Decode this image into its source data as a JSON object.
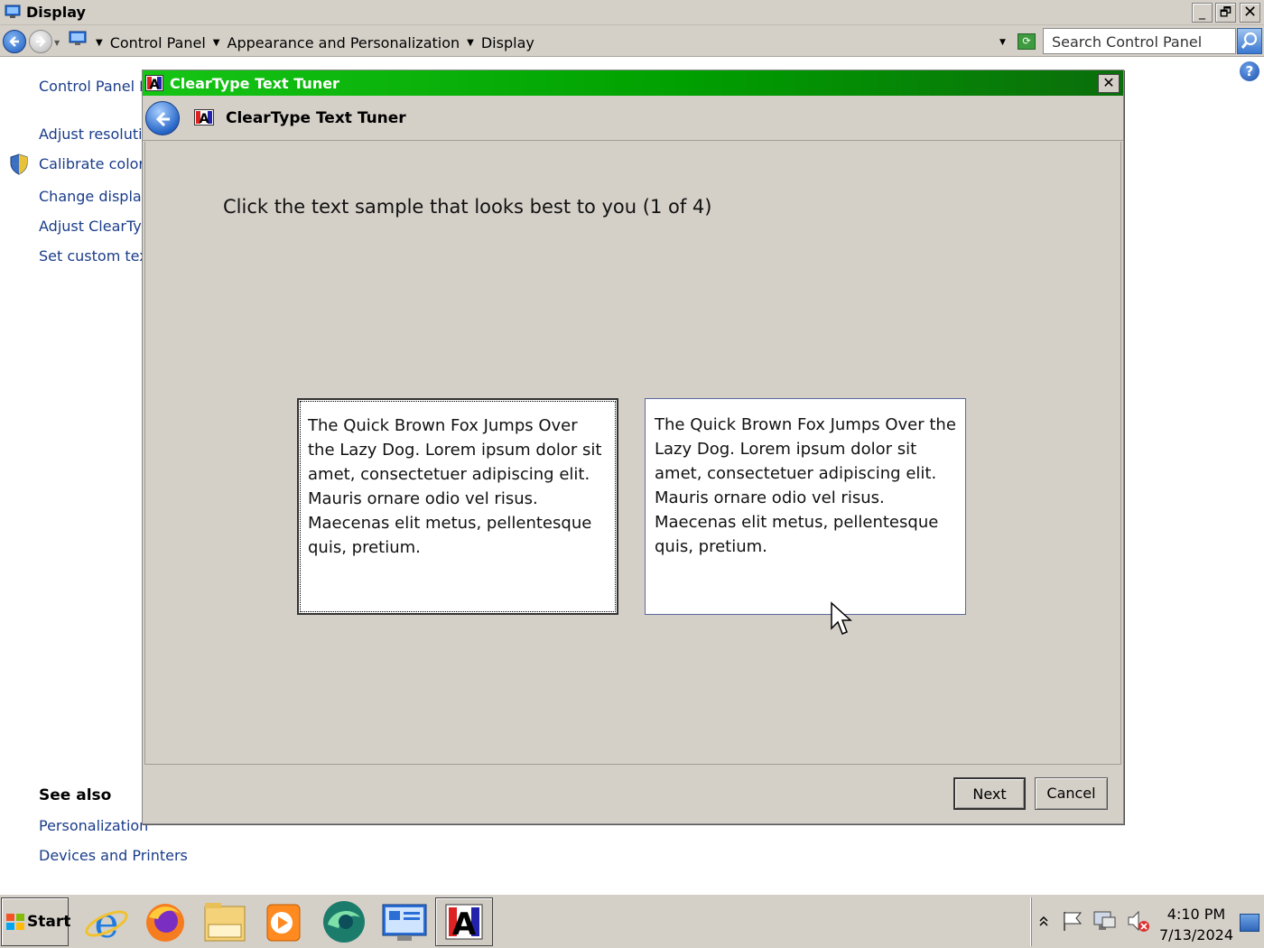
{
  "window": {
    "title": "Display",
    "controls": {
      "minimize": "_",
      "restore": "🗗",
      "close": "✕"
    }
  },
  "address": {
    "breadcrumbs": [
      "Control Panel",
      "Appearance and Personalization",
      "Display"
    ],
    "search_placeholder": "Search Control Panel"
  },
  "left_pane": {
    "links": [
      "Control Panel H",
      "Adjust resolutic",
      "Calibrate color",
      "Change display",
      "Adjust ClearTyı",
      "Set custom tex"
    ],
    "see_also_heading": "See also",
    "see_also_links": [
      "Personalization",
      "Devices and Printers"
    ]
  },
  "dialog": {
    "title": "ClearType Text Tuner",
    "header_title": "ClearType Text Tuner",
    "instruction": "Click the text sample that looks best to you (1 of 4)",
    "samples": [
      "The Quick Brown Fox Jumps Over the Lazy Dog. Lorem ipsum dolor sit amet, consectetuer adipiscing elit. Mauris ornare odio vel risus. Maecenas elit metus, pellentesque quis, pretium.",
      "The Quick Brown Fox Jumps Over the Lazy Dog. Lorem ipsum dolor sit amet, consectetuer adipiscing elit. Mauris ornare odio vel risus. Maecenas elit metus, pellentesque quis, pretium."
    ],
    "next_label": "Next",
    "cancel_label": "Cancel",
    "close_glyph": "✕"
  },
  "taskbar": {
    "start_label": "Start",
    "apps": [
      "internet-explorer-icon",
      "firefox-icon",
      "file-explorer-icon",
      "media-player-icon",
      "browser-icon",
      "control-panel-icon",
      "cleartype-icon"
    ],
    "clock_time": "4:10 PM",
    "clock_date": "7/13/2024"
  },
  "colors": {
    "dialog_title_start": "#15c515",
    "dialog_title_end": "#0b6d0b",
    "link": "#1a3c8a",
    "window_bg": "#d4d0c8"
  }
}
